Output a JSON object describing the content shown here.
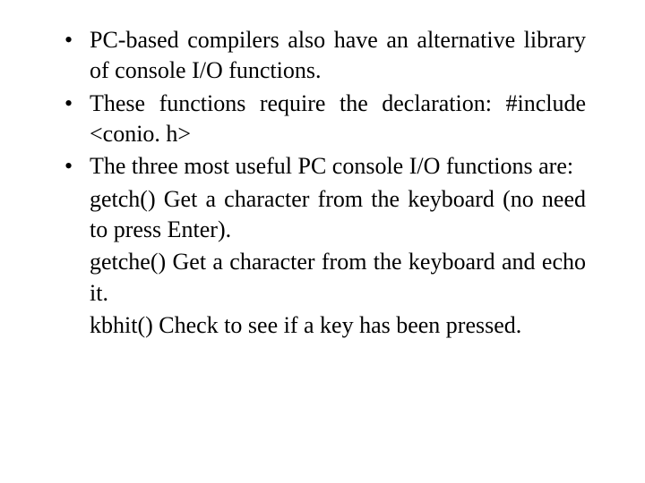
{
  "bullets": {
    "b1": "PC-based compilers also have an alternative library of console I/O functions.",
    "b2": "These functions require the declaration: #include <conio. h>",
    "b3": "The three most useful PC console I/O functions are:",
    "b3_sub1": "getch() Get a character from the keyboard (no need to press Enter).",
    "b3_sub2": "getche() Get a character from the keyboard and echo it.",
    "b3_sub3": "kbhit() Check to see if a key has been pressed."
  }
}
